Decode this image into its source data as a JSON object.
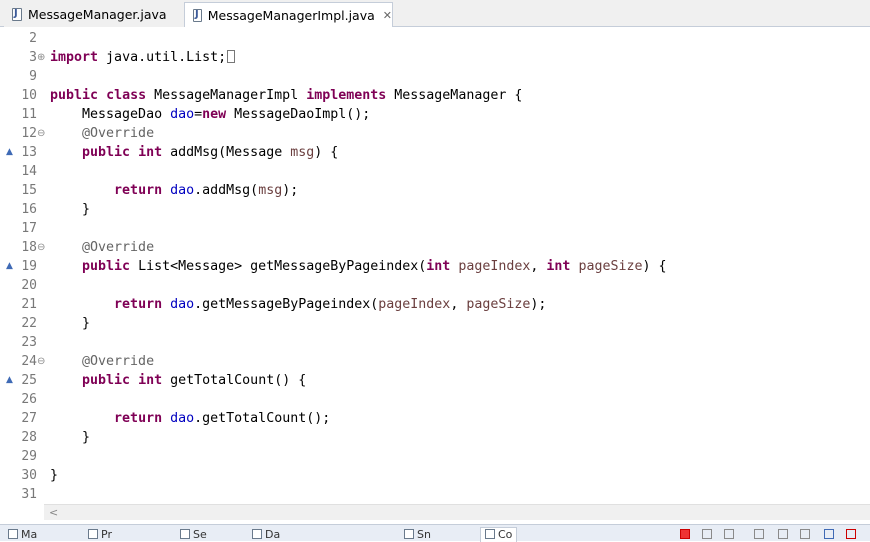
{
  "tabs": [
    {
      "label": "MessageManager.java",
      "active": false
    },
    {
      "label": "MessageManagerImpl.java",
      "active": true
    }
  ],
  "tab_close_icon": "✕",
  "editor": {
    "lines": [
      {
        "num": "2",
        "marker": "",
        "fold": "",
        "segments": []
      },
      {
        "num": "3",
        "marker": "",
        "fold": "⊕",
        "segments": [
          {
            "t": "import",
            "c": "kw"
          },
          {
            "t": " java.util.List;",
            "c": ""
          }
        ],
        "box": true
      },
      {
        "num": "9",
        "marker": "",
        "fold": "",
        "segments": []
      },
      {
        "num": "10",
        "marker": "",
        "fold": "",
        "segments": [
          {
            "t": "public",
            "c": "kw"
          },
          {
            "t": " ",
            "c": ""
          },
          {
            "t": "class",
            "c": "kw"
          },
          {
            "t": " MessageManagerImpl ",
            "c": ""
          },
          {
            "t": "implements",
            "c": "kw"
          },
          {
            "t": " MessageManager {",
            "c": ""
          }
        ]
      },
      {
        "num": "11",
        "marker": "",
        "fold": "",
        "segments": [
          {
            "t": "    MessageDao ",
            "c": ""
          },
          {
            "t": "dao",
            "c": "fld"
          },
          {
            "t": "=",
            "c": ""
          },
          {
            "t": "new",
            "c": "kw"
          },
          {
            "t": " MessageDaoImpl();",
            "c": ""
          }
        ]
      },
      {
        "num": "12",
        "marker": "",
        "fold": "⊖",
        "segments": [
          {
            "t": "    @Override",
            "c": "ann"
          }
        ]
      },
      {
        "num": "13",
        "marker": "▲",
        "fold": "",
        "segments": [
          {
            "t": "    ",
            "c": ""
          },
          {
            "t": "public",
            "c": "kw"
          },
          {
            "t": " ",
            "c": ""
          },
          {
            "t": "int",
            "c": "kw"
          },
          {
            "t": " addMsg(Message ",
            "c": ""
          },
          {
            "t": "msg",
            "c": "prm"
          },
          {
            "t": ") {",
            "c": ""
          }
        ]
      },
      {
        "num": "14",
        "marker": "",
        "fold": "",
        "segments": []
      },
      {
        "num": "15",
        "marker": "",
        "fold": "",
        "segments": [
          {
            "t": "        ",
            "c": ""
          },
          {
            "t": "return",
            "c": "kw"
          },
          {
            "t": " ",
            "c": ""
          },
          {
            "t": "dao",
            "c": "fld"
          },
          {
            "t": ".addMsg(",
            "c": ""
          },
          {
            "t": "msg",
            "c": "prm"
          },
          {
            "t": ");",
            "c": ""
          }
        ]
      },
      {
        "num": "16",
        "marker": "",
        "fold": "",
        "segments": [
          {
            "t": "    }",
            "c": ""
          }
        ]
      },
      {
        "num": "17",
        "marker": "",
        "fold": "",
        "segments": []
      },
      {
        "num": "18",
        "marker": "",
        "fold": "⊖",
        "segments": [
          {
            "t": "    @Override",
            "c": "ann"
          }
        ]
      },
      {
        "num": "19",
        "marker": "▲",
        "fold": "",
        "segments": [
          {
            "t": "    ",
            "c": ""
          },
          {
            "t": "public",
            "c": "kw"
          },
          {
            "t": " List<Message> getMessageByPageindex(",
            "c": ""
          },
          {
            "t": "int",
            "c": "kw"
          },
          {
            "t": " ",
            "c": ""
          },
          {
            "t": "pageIndex",
            "c": "prm"
          },
          {
            "t": ", ",
            "c": ""
          },
          {
            "t": "int",
            "c": "kw"
          },
          {
            "t": " ",
            "c": ""
          },
          {
            "t": "pageSize",
            "c": "prm"
          },
          {
            "t": ") {",
            "c": ""
          }
        ]
      },
      {
        "num": "20",
        "marker": "",
        "fold": "",
        "segments": []
      },
      {
        "num": "21",
        "marker": "",
        "fold": "",
        "segments": [
          {
            "t": "        ",
            "c": ""
          },
          {
            "t": "return",
            "c": "kw"
          },
          {
            "t": " ",
            "c": ""
          },
          {
            "t": "dao",
            "c": "fld"
          },
          {
            "t": ".getMessageByPageindex(",
            "c": ""
          },
          {
            "t": "pageIndex",
            "c": "prm"
          },
          {
            "t": ", ",
            "c": ""
          },
          {
            "t": "pageSize",
            "c": "prm"
          },
          {
            "t": ");",
            "c": ""
          }
        ]
      },
      {
        "num": "22",
        "marker": "",
        "fold": "",
        "segments": [
          {
            "t": "    }",
            "c": ""
          }
        ]
      },
      {
        "num": "23",
        "marker": "",
        "fold": "",
        "segments": []
      },
      {
        "num": "24",
        "marker": "",
        "fold": "⊖",
        "segments": [
          {
            "t": "    @Override",
            "c": "ann"
          }
        ]
      },
      {
        "num": "25",
        "marker": "▲",
        "fold": "",
        "segments": [
          {
            "t": "    ",
            "c": ""
          },
          {
            "t": "public",
            "c": "kw"
          },
          {
            "t": " ",
            "c": ""
          },
          {
            "t": "int",
            "c": "kw"
          },
          {
            "t": " getTotalCount() {",
            "c": ""
          }
        ]
      },
      {
        "num": "26",
        "marker": "",
        "fold": "",
        "segments": []
      },
      {
        "num": "27",
        "marker": "",
        "fold": "",
        "segments": [
          {
            "t": "        ",
            "c": ""
          },
          {
            "t": "return",
            "c": "kw"
          },
          {
            "t": " ",
            "c": ""
          },
          {
            "t": "dao",
            "c": "fld"
          },
          {
            "t": ".getTotalCount();",
            "c": ""
          }
        ]
      },
      {
        "num": "28",
        "marker": "",
        "fold": "",
        "segments": [
          {
            "t": "    }",
            "c": ""
          }
        ]
      },
      {
        "num": "29",
        "marker": "",
        "fold": "",
        "segments": []
      },
      {
        "num": "30",
        "marker": "",
        "fold": "",
        "segments": [
          {
            "t": "}",
            "c": ""
          }
        ]
      },
      {
        "num": "31",
        "marker": "",
        "fold": "",
        "segments": []
      }
    ]
  },
  "scroll_left_icon": "<",
  "bottom_tabs": [
    "Ma",
    "Pr",
    "Se",
    "Da",
    "Sn",
    "Co"
  ],
  "colors": {
    "keyword": "#7f0055",
    "field": "#0000c0",
    "annotation": "#646464",
    "parameter": "#6a3e3e",
    "line_number": "#787878"
  }
}
